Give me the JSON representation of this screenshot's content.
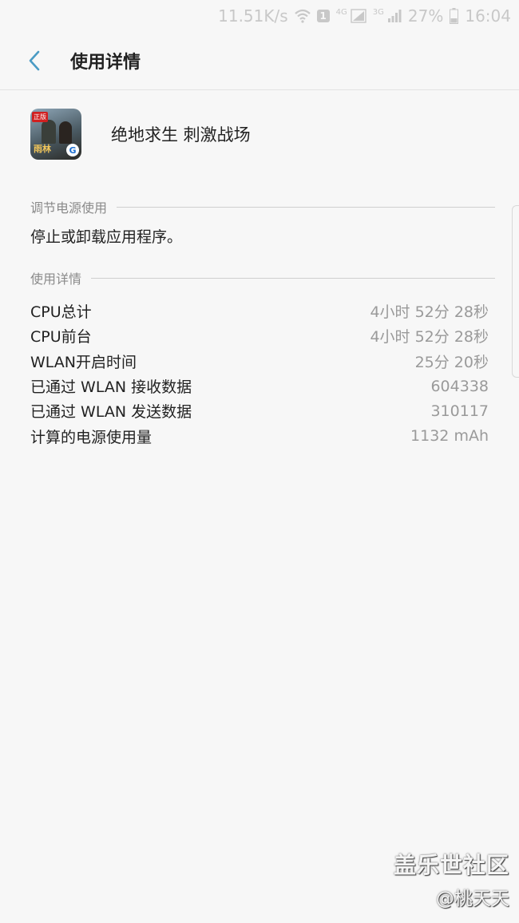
{
  "status_bar": {
    "net_speed": "11.51K/s",
    "sim_label": "1",
    "net1": "4G",
    "net2": "3G",
    "battery": "27%",
    "time": "16:04"
  },
  "header": {
    "title": "使用详情"
  },
  "app": {
    "name": "绝地求生 刺激战场",
    "icon_tag": "正版",
    "icon_brand": "雨林",
    "icon_logo": "G"
  },
  "power_section": {
    "header": "调节电源使用",
    "text": "停止或卸载应用程序。"
  },
  "details_section": {
    "header": "使用详情",
    "rows": [
      {
        "label": "CPU总计",
        "value": "4小时 52分 28秒"
      },
      {
        "label": "CPU前台",
        "value": "4小时 52分 28秒"
      },
      {
        "label": "WLAN开启时间",
        "value": "25分 20秒"
      },
      {
        "label": "已通过 WLAN 接收数据",
        "value": "604338"
      },
      {
        "label": "已通过 WLAN 发送数据",
        "value": "310117"
      },
      {
        "label": "计算的电源使用量",
        "value": "1132 mAh"
      }
    ]
  },
  "watermark": {
    "main": "盖乐世社区",
    "sub": "@桃天天"
  },
  "colors": {
    "accent": "#4a9bc4",
    "background": "#f7f7f7"
  }
}
